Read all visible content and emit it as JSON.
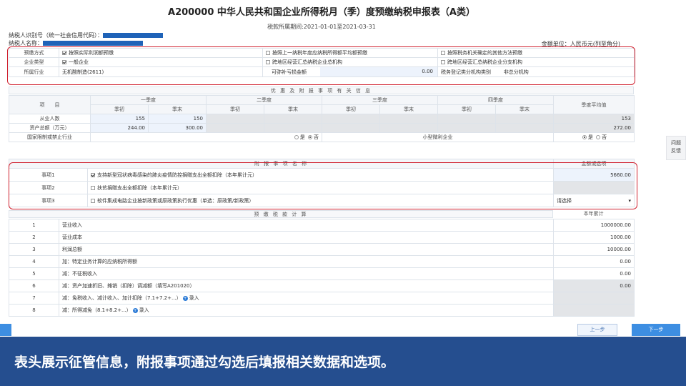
{
  "header": {
    "title": "A200000 中华人民共和国企业所得税月（季）度预缴纳税申报表（A类）",
    "period": "税款所属期间:2021-01-01至2021-03-31",
    "taxpayer_id_label": "纳税人识别号（统一社会信用代码）：",
    "taxpayer_name_label": "纳税人名称：",
    "unit": "金额单位：人民币元(列至角分)"
  },
  "info": {
    "prepay_method_label": "预缴方式",
    "prepay_options": [
      "按照实际利润额预缴",
      "按照上一纳税年度应纳税所得额平均额预缴",
      "按照税务机关确定的其他方法预缴"
    ],
    "enterprise_type_label": "企业类型",
    "enterprise_options": [
      "一般企业",
      "跨地区经营汇总纳税企业总机构",
      "跨地区经营汇总纳税企业分支机构"
    ],
    "industry_label": "所属行业",
    "industry_value": "无机酸制造(2611)",
    "loss_label": "可弥补亏损金额",
    "loss_value": "0.00",
    "branch_type_label": "税务登记类分机构类别",
    "branch_type_value": "非总分机构"
  },
  "preferential": {
    "bar": "优 惠 及 附 报 事 项 有 关 信 息",
    "item_label": "项　　目",
    "quarters": [
      "一季度",
      "二季度",
      "三季度",
      "四季度"
    ],
    "start_label": "季初",
    "end_label": "季末",
    "avg_label": "季度平均值",
    "employees_label": "从业人数",
    "employees_start": "155",
    "employees_end": "150",
    "employees_avg": "153",
    "assets_label": "资产总额（万元）",
    "assets_start": "244.00",
    "assets_end": "300.00",
    "assets_avg": "272.00",
    "restricted_label": "国家限制或禁止行业",
    "yes": "是",
    "no": "否",
    "small_label": "小型微利企业"
  },
  "attached": {
    "name_header": "附 报 事 项 名 称",
    "amount_header": "金额或选项",
    "items": [
      {
        "label": "事项1",
        "text": "支持新型冠状病毒感染的肺炎疫情防控捐赠支出全额扣除（本年累计元）",
        "value": "5660.00"
      },
      {
        "label": "事项2",
        "text": "扶贫捐赠支出全额扣除（本年累计元）",
        "value": ""
      },
      {
        "label": "事项3",
        "text": "软件集成电路企业按新政策或原政策执行优惠（单选：原政策/新政策）",
        "value": "请选择"
      }
    ]
  },
  "calc": {
    "bar": "预 缴 税 款 计 算",
    "cumulative_label": "本年累计",
    "rows": [
      {
        "num": "1",
        "label": "营业收入",
        "value": "1000000.00"
      },
      {
        "num": "2",
        "label": "营业成本",
        "value": "1000.00"
      },
      {
        "num": "3",
        "label": "利润总额",
        "value": "10000.00"
      },
      {
        "num": "4",
        "label": "加：特定业务计算的应纳税所得额",
        "value": "0.00"
      },
      {
        "num": "5",
        "label": "减：不征税收入",
        "value": "0.00"
      },
      {
        "num": "6",
        "label": "减：资产加速折旧、摊销（扣除）调减额（填写A201020）",
        "value": "0.00"
      },
      {
        "num": "7",
        "label": "减：免税收入、减计收入、加计扣除（7.1+7.2+...）",
        "value": "",
        "entry": "录入"
      },
      {
        "num": "8",
        "label": "减：所得减免（8.1+8.2+...）",
        "value": "",
        "entry": "录入"
      }
    ]
  },
  "side_tab": [
    "问题",
    "反馈"
  ],
  "buttons": {
    "prev": "上一步",
    "next": "下一步"
  },
  "caption": "表头展示征管信息，附报事项通过勾选后填报相关数据和选项。",
  "colors": {
    "highlight_box": "#d0202e",
    "caption_bg": "#254e8f",
    "primary_button": "#3d8ee2"
  }
}
